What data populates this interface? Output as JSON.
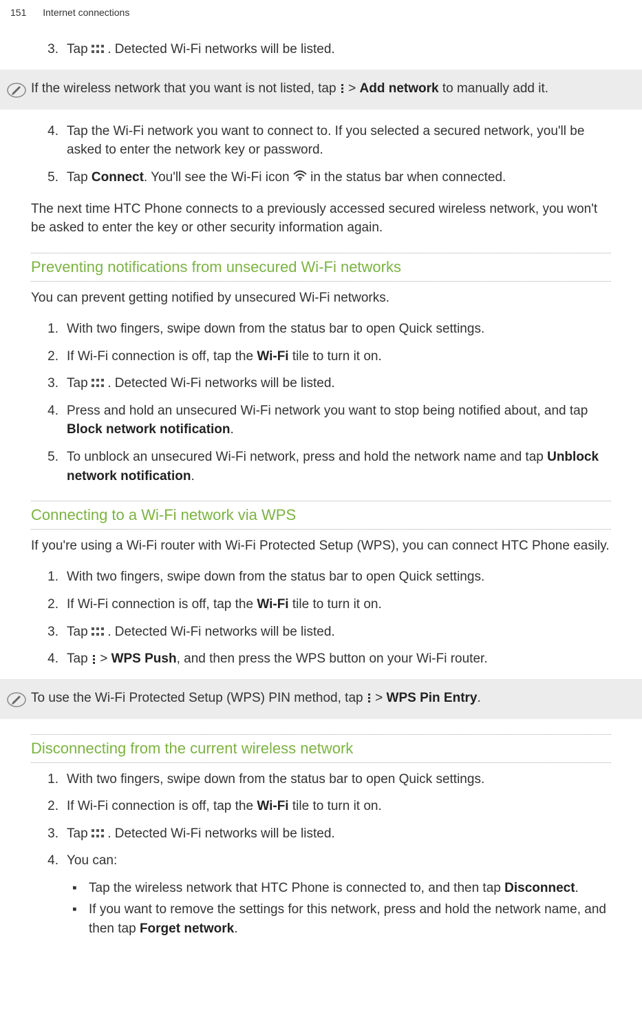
{
  "header": {
    "page": "151",
    "section": "Internet connections"
  },
  "step3": {
    "num": "3.",
    "text_a": "Tap ",
    "text_b": ". Detected Wi-Fi networks will be listed."
  },
  "note1": {
    "text_a": "If the wireless network that you want is not listed, tap ",
    "text_b": " > ",
    "bold": "Add network",
    "text_c": " to manually add it."
  },
  "step4": {
    "num": "4.",
    "text": "Tap the Wi-Fi network you want to connect to. If you selected a secured network, you'll be asked to enter the network key or password."
  },
  "step5": {
    "num": "5.",
    "text_a": "Tap ",
    "bold": "Connect",
    "text_b": ". You'll see the Wi-Fi icon ",
    "text_c": " in the status bar when connected."
  },
  "para1": "The next time HTC Phone connects to a previously accessed secured wireless network, you won't be asked to enter the key or other security information again.",
  "heading1": "Preventing notifications from unsecured Wi-Fi networks",
  "para2": "You can prevent getting notified by unsecured Wi-Fi networks.",
  "s2_1": {
    "num": "1.",
    "text": "With two fingers, swipe down from the status bar to open Quick settings."
  },
  "s2_2": {
    "num": "2.",
    "text_a": "If Wi-Fi connection is off, tap the ",
    "bold": "Wi-Fi",
    "text_b": " tile to turn it on."
  },
  "s2_3": {
    "num": "3.",
    "text_a": "Tap ",
    "text_b": ". Detected Wi-Fi networks will be listed."
  },
  "s2_4": {
    "num": "4.",
    "text_a": "Press and hold an unsecured Wi-Fi network you want to stop being notified about, and tap ",
    "bold": "Block network notification",
    "text_b": "."
  },
  "s2_5": {
    "num": "5.",
    "text_a": "To unblock an unsecured Wi-Fi network, press and hold the network name and tap ",
    "bold": "Unblock network notification",
    "text_b": "."
  },
  "heading2": "Connecting to a Wi-Fi network via WPS",
  "para3": "If you're using a Wi-Fi router with Wi-Fi Protected Setup (WPS), you can connect HTC Phone easily.",
  "s3_1": {
    "num": "1.",
    "text": "With two fingers, swipe down from the status bar to open Quick settings."
  },
  "s3_2": {
    "num": "2.",
    "text_a": "If Wi-Fi connection is off, tap the ",
    "bold": "Wi-Fi",
    "text_b": " tile to turn it on."
  },
  "s3_3": {
    "num": "3.",
    "text_a": "Tap ",
    "text_b": ". Detected Wi-Fi networks will be listed."
  },
  "s3_4": {
    "num": "4.",
    "text_a": "Tap ",
    "text_b": " > ",
    "bold": "WPS Push",
    "text_c": ", and then press the WPS button on your Wi-Fi router."
  },
  "note2": {
    "text_a": "To use the Wi-Fi Protected Setup (WPS) PIN method, tap ",
    "text_b": " > ",
    "bold": "WPS Pin Entry",
    "text_c": "."
  },
  "heading3": "Disconnecting from the current wireless network",
  "s4_1": {
    "num": "1.",
    "text": "With two fingers, swipe down from the status bar to open Quick settings."
  },
  "s4_2": {
    "num": "2.",
    "text_a": "If Wi-Fi connection is off, tap the ",
    "bold": "Wi-Fi",
    "text_b": " tile to turn it on."
  },
  "s4_3": {
    "num": "3.",
    "text_a": "Tap ",
    "text_b": ". Detected Wi-Fi networks will be listed."
  },
  "s4_4": {
    "num": "4.",
    "text": "You can:"
  },
  "b1": {
    "text_a": "Tap the wireless network that HTC Phone is connected to, and then tap ",
    "bold": "Disconnect",
    "text_b": "."
  },
  "b2": {
    "text_a": "If you want to remove the settings for this network, press and hold the network name, and then tap ",
    "bold": "Forget network",
    "text_b": "."
  }
}
